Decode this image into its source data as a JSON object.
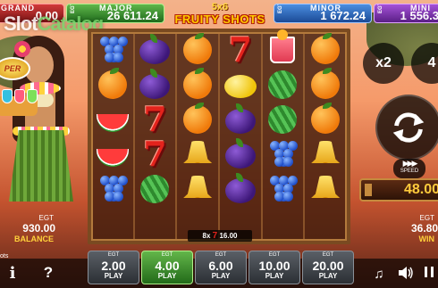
{
  "watermark": {
    "slot": "Slot",
    "catalog": "Catalog"
  },
  "jackpots": {
    "grand": {
      "name": "GRAND",
      "value": "0.00",
      "egt": "EGT"
    },
    "major": {
      "name": "MAJOR",
      "value": "26 611.24",
      "egt": "EGT"
    },
    "minor": {
      "name": "MINOR",
      "value": "1 672.24",
      "egt": "EGT"
    },
    "mini": {
      "name": "MINI",
      "value": "1 556.3",
      "egt": "EGT"
    }
  },
  "title": {
    "line1": "5x6",
    "line2": "FRUITY SHOTS"
  },
  "character": {
    "badge_text": "PER"
  },
  "reels": {
    "columns": 6,
    "rows": 6,
    "symbols": [
      [
        "grapes",
        "plum",
        "orange",
        "seven",
        "cocktail",
        "orange"
      ],
      [
        "orange",
        "plum",
        "orange",
        "lemon",
        "melon-whole",
        "orange"
      ],
      [
        "melon",
        "seven",
        "orange",
        "plum",
        "melon-whole",
        "orange"
      ],
      [
        "melon",
        "seven",
        "bell",
        "plum",
        "grapes",
        "bell"
      ],
      [
        "grapes",
        "melon-whole",
        "bell",
        "plum",
        "grapes",
        "bell"
      ],
      [
        "",
        "",
        "",
        "",
        "",
        ""
      ]
    ]
  },
  "win_line": {
    "count": "8x",
    "amount": "16.00"
  },
  "controls": {
    "x2_label": "x2",
    "next_label": "4",
    "speed_label": "SPEED",
    "bet_value": "48.00"
  },
  "balance": {
    "egt": "EGT",
    "amount": "930.00",
    "label": "BALANCE"
  },
  "win": {
    "egt": "EGT",
    "amount": "36.80",
    "label": "WIN"
  },
  "misc": {
    "tiny": "ots"
  },
  "bottom": {
    "info": "i",
    "help": "?",
    "bets": [
      {
        "egt": "EGT",
        "value": "2.00",
        "play": "PLAY",
        "active": false
      },
      {
        "egt": "EGT",
        "value": "4.00",
        "play": "PLAY",
        "active": true
      },
      {
        "egt": "EGT",
        "value": "6.00",
        "play": "PLAY",
        "active": false
      },
      {
        "egt": "EGT",
        "value": "10.00",
        "play": "PLAY",
        "active": false
      },
      {
        "egt": "EGT",
        "value": "20.00",
        "play": "PLAY",
        "active": false
      }
    ],
    "music_icon": "music-note-icon",
    "sound_icon": "speaker-icon",
    "menu_icon": "pause-icon"
  }
}
